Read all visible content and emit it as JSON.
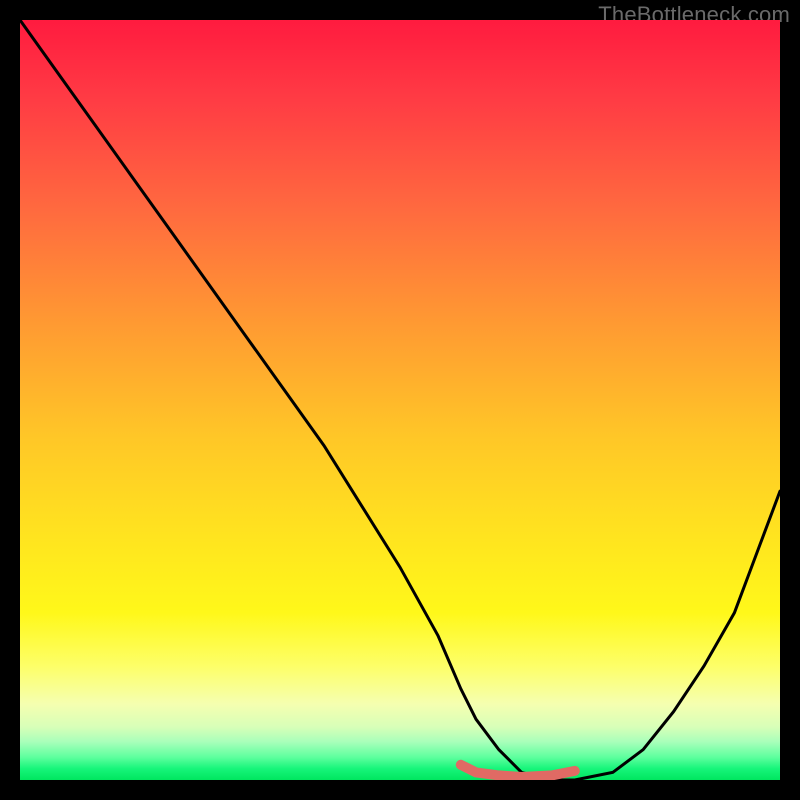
{
  "watermark": "TheBottleneck.com",
  "chart_data": {
    "type": "line",
    "title": "",
    "xlabel": "",
    "ylabel": "",
    "xlim": [
      0,
      100
    ],
    "ylim": [
      0,
      100
    ],
    "grid": false,
    "series": [
      {
        "name": "bottleneck-curve",
        "x": [
          0,
          5,
          10,
          15,
          20,
          25,
          30,
          35,
          40,
          45,
          50,
          55,
          58,
          60,
          63,
          66,
          70,
          73,
          78,
          82,
          86,
          90,
          94,
          97,
          100
        ],
        "values": [
          100,
          93,
          86,
          79,
          72,
          65,
          58,
          51,
          44,
          36,
          28,
          19,
          12,
          8,
          4,
          1,
          0,
          0,
          1,
          4,
          9,
          15,
          22,
          30,
          38
        ],
        "color": "#000000"
      },
      {
        "name": "optimal-band",
        "x": [
          58,
          60,
          63,
          66,
          70,
          73
        ],
        "values": [
          2,
          1,
          0.6,
          0.4,
          0.6,
          1.2
        ],
        "color": "#e06a64"
      }
    ],
    "colors": {
      "gradient_top": "#ff1b3f",
      "gradient_mid": "#ffe41f",
      "gradient_bottom": "#00e65f",
      "curve": "#000000",
      "optimal_band": "#e06a64",
      "frame": "#000000"
    }
  }
}
